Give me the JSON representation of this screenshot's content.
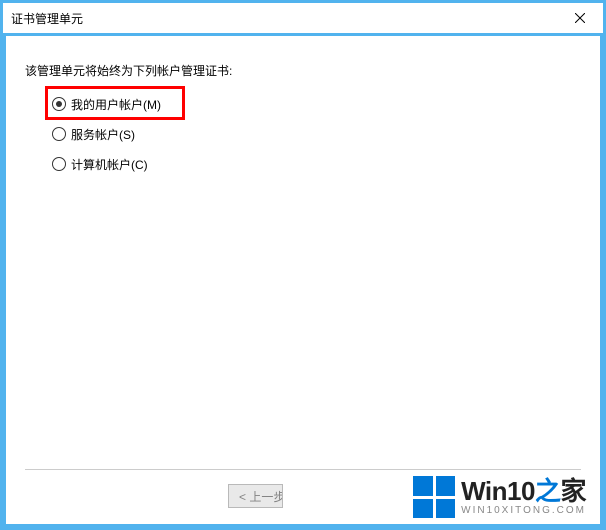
{
  "window": {
    "title": "证书管理单元"
  },
  "instruction": "该管理单元将始终为下列帐户管理证书:",
  "radios": {
    "my_user": {
      "label": "我的用户帐户(M)",
      "checked": true
    },
    "service": {
      "label": "服务帐户(S)",
      "checked": false
    },
    "computer": {
      "label": "计算机帐户(C)",
      "checked": false
    }
  },
  "buttons": {
    "back": "< 上一步"
  },
  "watermark": {
    "brand_a": "Win10",
    "brand_b": "之",
    "brand_c": "家",
    "sub": "WIN10XITONG.COM"
  }
}
